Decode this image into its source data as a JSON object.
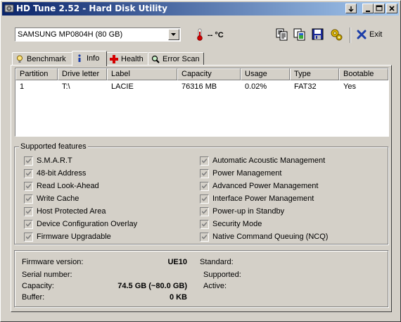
{
  "window": {
    "title": "HD Tune 2.52 - Hard Disk Utility",
    "buttons": {
      "help": "▼",
      "minimize": "_",
      "maximize": "□",
      "close": "✕"
    }
  },
  "toolbar": {
    "drive": "SAMSUNG MP0804H (80 GB)",
    "temperature": "-- °C",
    "exit_label": "Exit",
    "icons": [
      "copy-text-icon",
      "copy-screenshot-icon",
      "save-icon",
      "options-icon",
      "exit-icon"
    ]
  },
  "tabs": [
    {
      "label": "Benchmark",
      "icon": "benchmark-icon",
      "active": false
    },
    {
      "label": "Info",
      "icon": "info-icon",
      "active": true
    },
    {
      "label": "Health",
      "icon": "health-icon",
      "active": false
    },
    {
      "label": "Error Scan",
      "icon": "error-scan-icon",
      "active": false
    }
  ],
  "partitions": {
    "columns": [
      "Partition",
      "Drive letter",
      "Label",
      "Capacity",
      "Usage",
      "Type",
      "Bootable"
    ],
    "rows": [
      [
        "1",
        "T:\\",
        "LACIE",
        "76316 MB",
        "0.02%",
        "FAT32",
        "Yes"
      ]
    ]
  },
  "features": {
    "title": "Supported features",
    "left": [
      "S.M.A.R.T",
      "48-bit Address",
      "Read Look-Ahead",
      "Write Cache",
      "Host Protected Area",
      "Device Configuration Overlay",
      "Firmware Upgradable"
    ],
    "right": [
      "Automatic Acoustic Management",
      "Power Management",
      "Advanced Power Management",
      "Interface Power Management",
      "Power-up in Standby",
      "Security Mode",
      "Native Command Queuing (NCQ)"
    ]
  },
  "details": {
    "firmware_label": "Firmware version:",
    "firmware_value": "UE10",
    "serial_label": "Serial number:",
    "serial_value": "",
    "capacity_label": "Capacity:",
    "capacity_value": "74.5 GB (~80.0 GB)",
    "buffer_label": "Buffer:",
    "buffer_value": "0 KB",
    "standard_label": "Standard:",
    "supported_label": "Supported:",
    "active_label": "Active:"
  }
}
